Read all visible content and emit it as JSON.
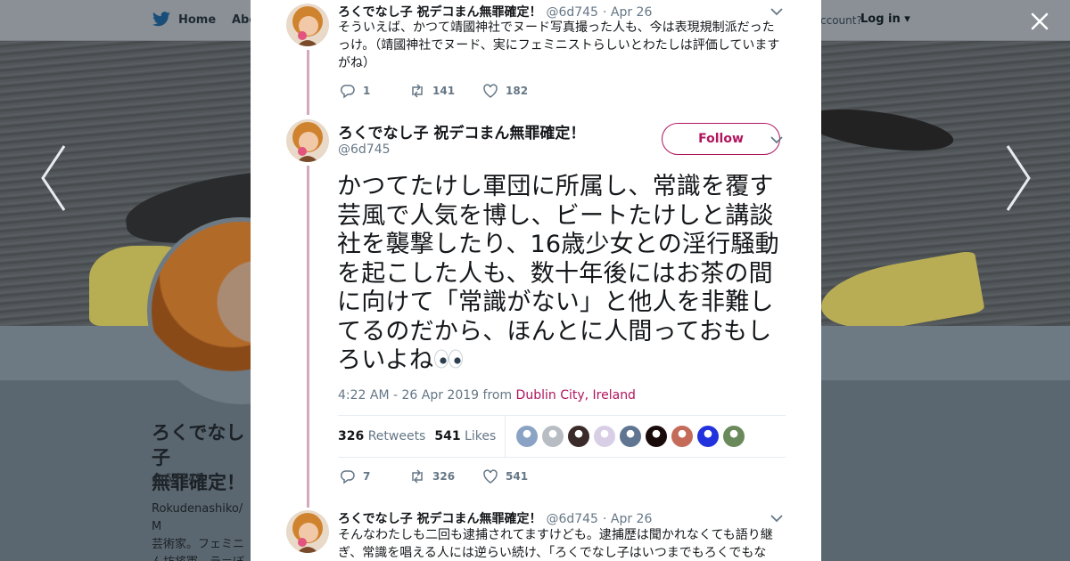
{
  "nav": {
    "home": "Home",
    "about": "Abo",
    "account": "ccount?",
    "login": "Log in"
  },
  "profile": {
    "name": "ろくでなし子\n無罪確定！",
    "handle": "@6d745",
    "bio": "Rokudenashiko/ M\n芸術家。フェミニ\nん坊将軍。ラ＝ぼ"
  },
  "tweets": {
    "prev": {
      "name": "ろくでなし子 祝デコまん無罪確定！",
      "handle": "@6d745",
      "date": "· Apr 26",
      "text": "そういえば、かつて靖國神社でヌード写真撮った人も、今は表現規制派だったっけ。（靖國神社でヌード、実にフェミニストらしいとわたしは評価していますがね）",
      "replies": "1",
      "retweets": "141",
      "likes": "182"
    },
    "main": {
      "name": "ろくでなし子 祝デコまん無罪確定！",
      "handle": "@6d745",
      "follow": "Follow",
      "text": "かつてたけし軍団に所属し、常識を覆す芸風で人気を博し、ビートたけしと講談社を襲撃したり、16歳少女との淫行騒動を起こした人も、数十年後にはお茶の間に向けて「常識がない」と他人を非難してるのだから、ほんとに人間っておもしろいよね",
      "time": "4:22 AM - 26 Apr 2019 from",
      "place": "Dublin City, Ireland",
      "retweet_count": "326",
      "retweet_label": "Retweets",
      "like_count": "541",
      "like_label": "Likes",
      "replies": "7",
      "retweets": "326",
      "likes": "541",
      "likers": [
        "#8aa3c4",
        "#b7bdc3",
        "#3b2a2a",
        "#d8cfe6",
        "#5f7592",
        "#1a0b0b",
        "#c56b5a",
        "#2233dd",
        "#6a8a5c"
      ]
    },
    "next": {
      "name": "ろくでなし子 祝デコまん無罪確定！",
      "handle": "@6d745",
      "date": "· Apr 26",
      "text": "そんなわたしも二回も逮捕されてますけども。逮捕歴は聞かれなくても語り継ぎ、常識を唱える人には逆らい続け、「ろくでなし子はいつまでもろくでもな"
    }
  },
  "colors": {
    "accent": "#b0155e",
    "thread": "#d4a8bd",
    "muted": "#657786"
  }
}
